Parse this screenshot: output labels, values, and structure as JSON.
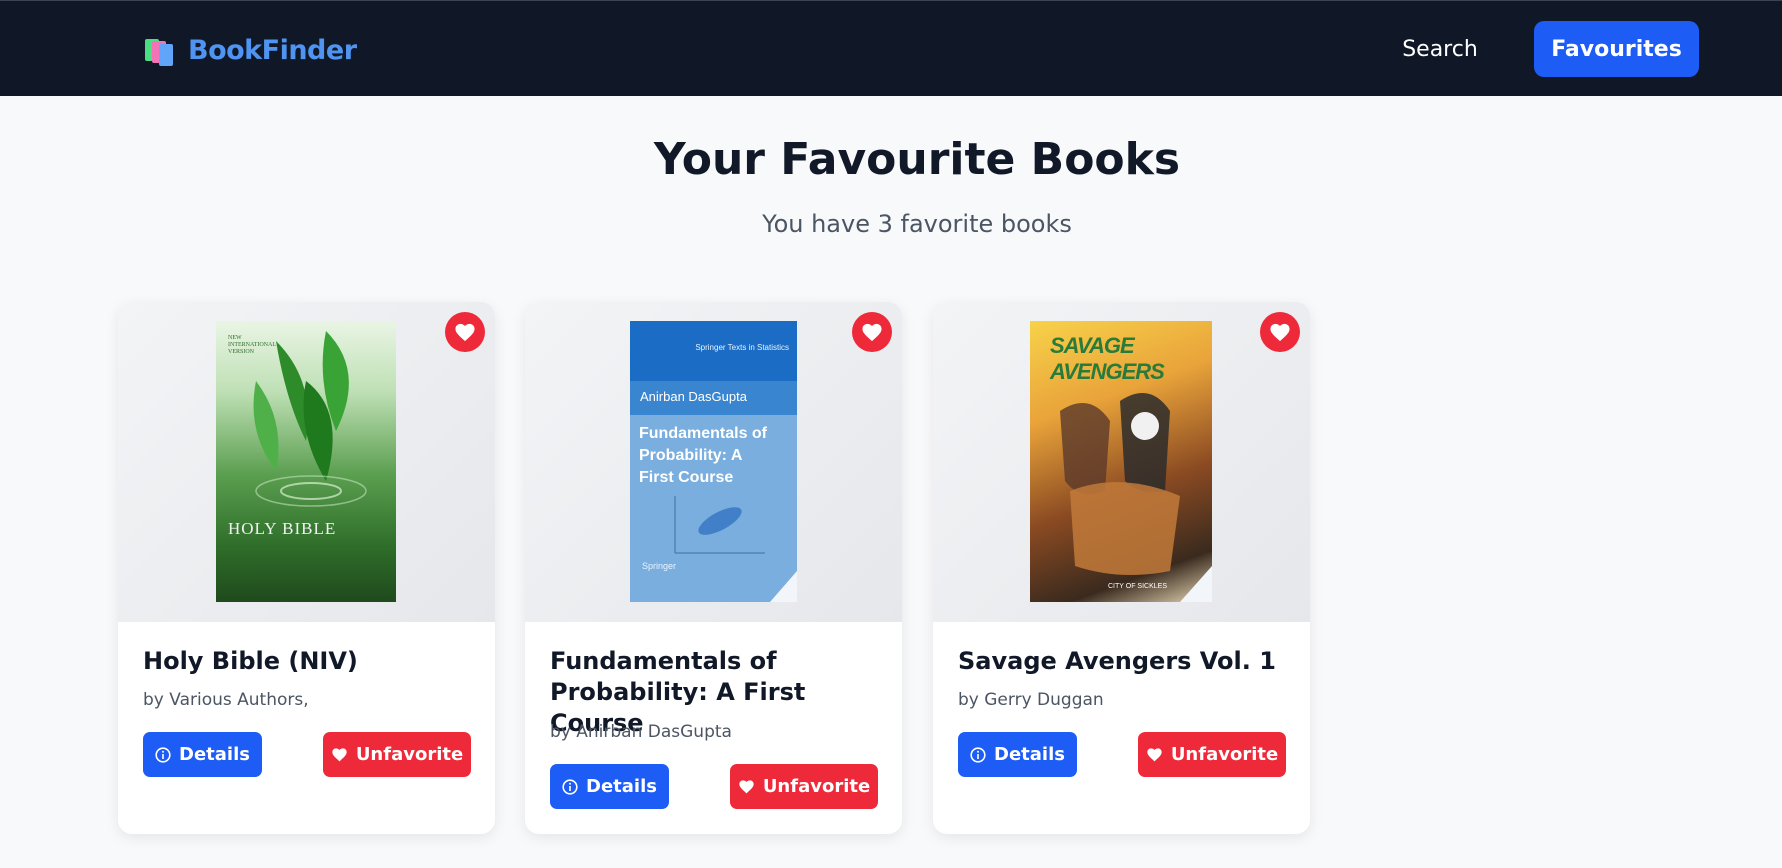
{
  "navbar": {
    "brand": "BookFinder",
    "search_label": "Search",
    "favourites_label": "Favourites"
  },
  "header": {
    "title": "Your Favourite Books",
    "subtitle": "You have 3 favorite books"
  },
  "books": [
    {
      "title": "Holy Bible (NIV)",
      "author": "by Various Authors,",
      "cover_text": "HOLY BIBLE",
      "cover_top_text": "NEW INTERNATIONAL VERSION",
      "details_label": "Details",
      "unfavorite_label": "Unfavorite"
    },
    {
      "title": "Fundamentals of Probability: A First Course",
      "author": "by Anirban DasGupta",
      "cover_series": "Springer Texts in Statistics",
      "cover_author": "Anirban DasGupta",
      "cover_title": "Fundamentals of Probability: A First Course",
      "cover_publisher": "Springer",
      "details_label": "Details",
      "unfavorite_label": "Unfavorite"
    },
    {
      "title": "Savage Avengers Vol. 1",
      "author": "by Gerry Duggan",
      "cover_title": "SAVAGE AVENGERS",
      "cover_bottom": "CITY OF SICKLES",
      "details_label": "Details",
      "unfavorite_label": "Unfavorite"
    }
  ],
  "colors": {
    "navbar_bg": "#101828",
    "brand": "#4f94f0",
    "primary": "#1d5cf5",
    "danger": "#ee2a3a",
    "page_bg": "#f8f9fb"
  },
  "icons": {
    "brand": "books-icon",
    "favorite": "heart-icon",
    "details": "info-circle-icon"
  }
}
